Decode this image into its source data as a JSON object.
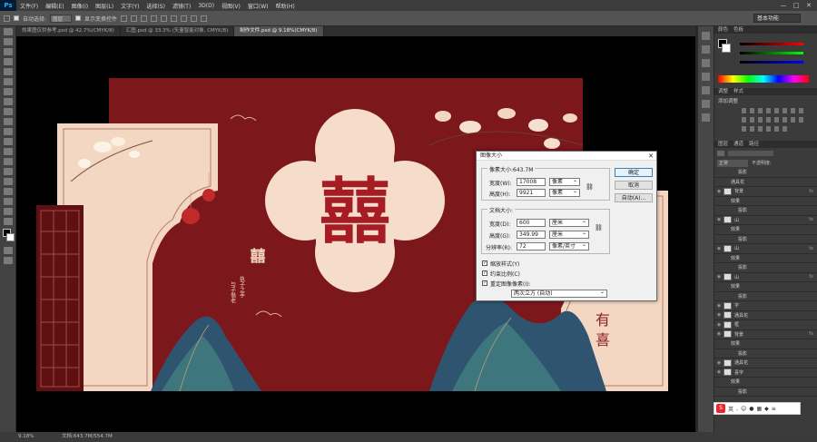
{
  "menubar": {
    "logo": "Ps",
    "items": [
      "文件(F)",
      "编辑(E)",
      "图像(I)",
      "图层(L)",
      "文字(Y)",
      "选择(S)",
      "滤镜(T)",
      "3D(D)",
      "视图(V)",
      "窗口(W)",
      "帮助(H)"
    ],
    "minimize": "—",
    "maximize": "□",
    "close": "✕"
  },
  "options": {
    "auto_select_label": "自动选择:",
    "auto_select_value": "图层",
    "show_transform_label": "显示变换控件",
    "workspace": "基本功能"
  },
  "tabs": [
    {
      "label": "效果图仅供参考.psd @ 42.7%(CMYK/8)",
      "active": false
    },
    {
      "label": "汇图.psd @ 33.3% (矢量智能对象, CMYK/8)",
      "active": false
    },
    {
      "label": "制作文件.psd @ 9.18%(CMYK/8)",
      "active": true
    }
  ],
  "statusbar": {
    "zoom": "9.18%",
    "doc": "文档:643.7M/554.7M"
  },
  "artwork": {
    "center_char": "囍",
    "left_char": "囍",
    "poem_lines": [
      "执子之手",
      "与子偕老"
    ],
    "right_text_1": "有",
    "right_text_2": "喜",
    "colors": {
      "bg": "#7c171c",
      "cream": "#f6dcca",
      "dark_red": "#5e1013",
      "gold": "#c9a27a",
      "mountain": "#2f5470"
    }
  },
  "panels": {
    "color_tabs": [
      "颜色",
      "色板"
    ],
    "adjust_tabs": [
      "调整",
      "样式"
    ],
    "adjust_title": "添加调整",
    "layer_tabs": [
      "图层",
      "通道",
      "路径"
    ],
    "blend_mode": "正常",
    "opacity_label": "不透明度:",
    "layers": [
      {
        "name": "投影",
        "indent": 2,
        "fx": false
      },
      {
        "name": "通具花",
        "indent": 1,
        "fx": false
      },
      {
        "name": "背景",
        "indent": 0,
        "fx": true
      },
      {
        "name": "效果",
        "indent": 1,
        "fx": false
      },
      {
        "name": "投影",
        "indent": 2,
        "fx": false
      },
      {
        "name": "山",
        "indent": 0,
        "fx": true
      },
      {
        "name": "效果",
        "indent": 1,
        "fx": false
      },
      {
        "name": "投影",
        "indent": 2,
        "fx": false
      },
      {
        "name": "山",
        "indent": 0,
        "fx": true
      },
      {
        "name": "效果",
        "indent": 1,
        "fx": false
      },
      {
        "name": "投影",
        "indent": 2,
        "fx": false
      },
      {
        "name": "山",
        "indent": 0,
        "fx": true
      },
      {
        "name": "效果",
        "indent": 1,
        "fx": false
      },
      {
        "name": "投影",
        "indent": 2,
        "fx": false
      },
      {
        "name": "字",
        "indent": 0,
        "fx": false
      },
      {
        "name": "通具花",
        "indent": 0,
        "fx": false
      },
      {
        "name": "框",
        "indent": 0,
        "fx": false
      },
      {
        "name": "背景",
        "indent": 0,
        "fx": true
      },
      {
        "name": "效果",
        "indent": 1,
        "fx": false
      },
      {
        "name": "投影",
        "indent": 2,
        "fx": false
      },
      {
        "name": "通具花",
        "indent": 0,
        "fx": false
      },
      {
        "name": "喜字",
        "indent": 0,
        "fx": false
      },
      {
        "name": "效果",
        "indent": 1,
        "fx": false
      },
      {
        "name": "投影",
        "indent": 2,
        "fx": false
      }
    ]
  },
  "dialog": {
    "title": "图像大小",
    "pixel_dims_label": "像素大小:643.7M",
    "width_label": "宽度(W):",
    "width_value": "17008",
    "width_unit": "像素",
    "height_label": "高度(H):",
    "height_value": "9921",
    "height_unit": "像素",
    "doc_size_label": "文档大小:",
    "doc_width_label": "宽度(D):",
    "doc_width_value": "600",
    "doc_width_unit": "厘米",
    "doc_height_label": "高度(G):",
    "doc_height_value": "349.99",
    "doc_height_unit": "厘米",
    "resolution_label": "分辨率(R):",
    "resolution_value": "72",
    "resolution_unit": "像素/英寸",
    "scale_styles": "缩放样式(Y)",
    "constrain": "约束比例(C)",
    "resample": "重定图像像素(I):",
    "resample_method": "两次立方 (自动)",
    "ok": "确定",
    "cancel": "取消",
    "auto": "自动(A)..."
  },
  "ime": {
    "logo": "S",
    "lang": "英"
  }
}
